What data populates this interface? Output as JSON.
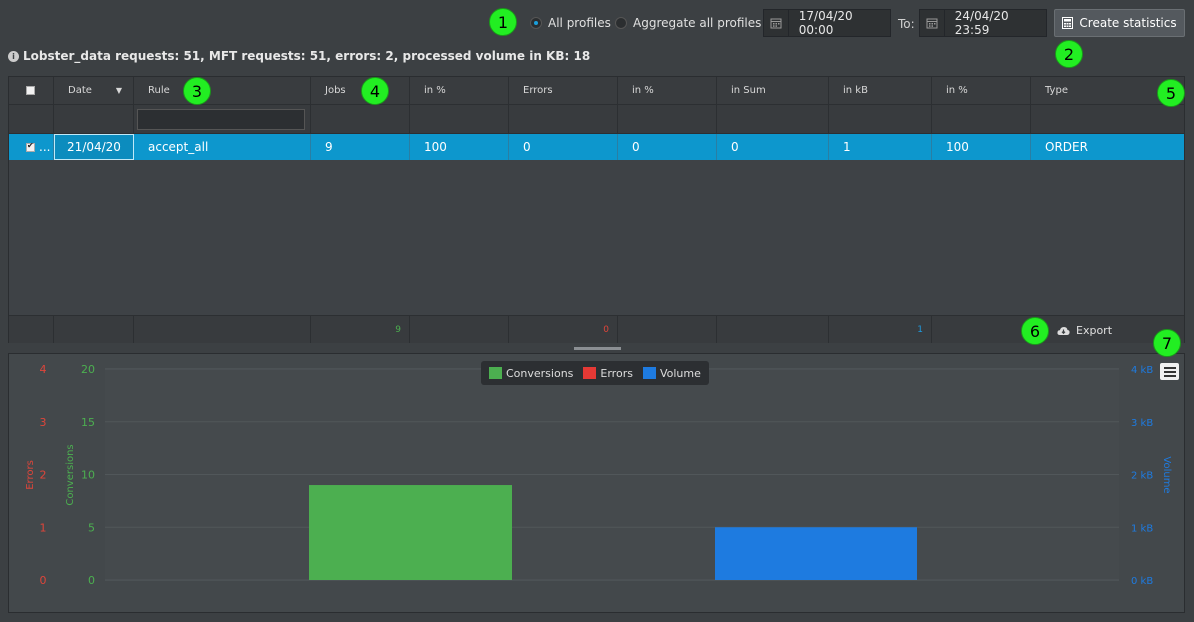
{
  "toolbar": {
    "radio_all_profiles": "All profiles",
    "radio_aggregate": "Aggregate all profiles",
    "date_from": "17/04/20 00:00",
    "to_label": "To:",
    "date_to": "24/04/20 23:59",
    "create_statistics": "Create statistics"
  },
  "summary": "Lobster_data requests: 51, MFT requests: 51, errors: 2, processed volume in KB: 18",
  "grid": {
    "columns": [
      "Date",
      "Rule",
      "Jobs",
      "in %",
      "Errors",
      "in %",
      "in Sum",
      "in kB",
      "in %",
      "Type"
    ],
    "selected_row": {
      "ellipsis": "...",
      "date": "21/04/20",
      "rule": "accept_all",
      "jobs": "9",
      "jobs_pct": "100",
      "errors": "0",
      "errors_pct": "0",
      "in_sum": "0",
      "in_kb": "1",
      "in_kb_pct": "100",
      "type": "ORDER"
    },
    "footer": {
      "jobs": "9",
      "errors": "0",
      "in_kb": "1"
    },
    "export_label": "Export"
  },
  "chart_data": {
    "type": "bar",
    "legend": [
      "Conversions",
      "Errors",
      "Volume"
    ],
    "series": [
      {
        "name": "Conversions",
        "values": [
          9
        ],
        "color": "#4caf50"
      },
      {
        "name": "Errors",
        "values": [
          0
        ],
        "color": "#e53935"
      },
      {
        "name": "Volume",
        "values": [
          1
        ],
        "color": "#1e7be0"
      }
    ],
    "axes": {
      "errors": {
        "label": "Errors",
        "ticks": [
          "0",
          "1",
          "2",
          "3",
          "4"
        ],
        "range": [
          0,
          4
        ],
        "color": "#e0453a"
      },
      "conversions": {
        "label": "Conversions",
        "ticks": [
          "0",
          "5",
          "10",
          "15",
          "20"
        ],
        "range": [
          0,
          20
        ],
        "color": "#4caf50"
      },
      "volume": {
        "label": "Volume",
        "ticks": [
          "0 kB",
          "1 kB",
          "2 kB",
          "3 kB",
          "4 kB"
        ],
        "range": [
          0,
          4
        ],
        "color": "#1e7be0"
      }
    }
  },
  "annotations": [
    "1",
    "2",
    "3",
    "4",
    "5",
    "6",
    "7"
  ]
}
